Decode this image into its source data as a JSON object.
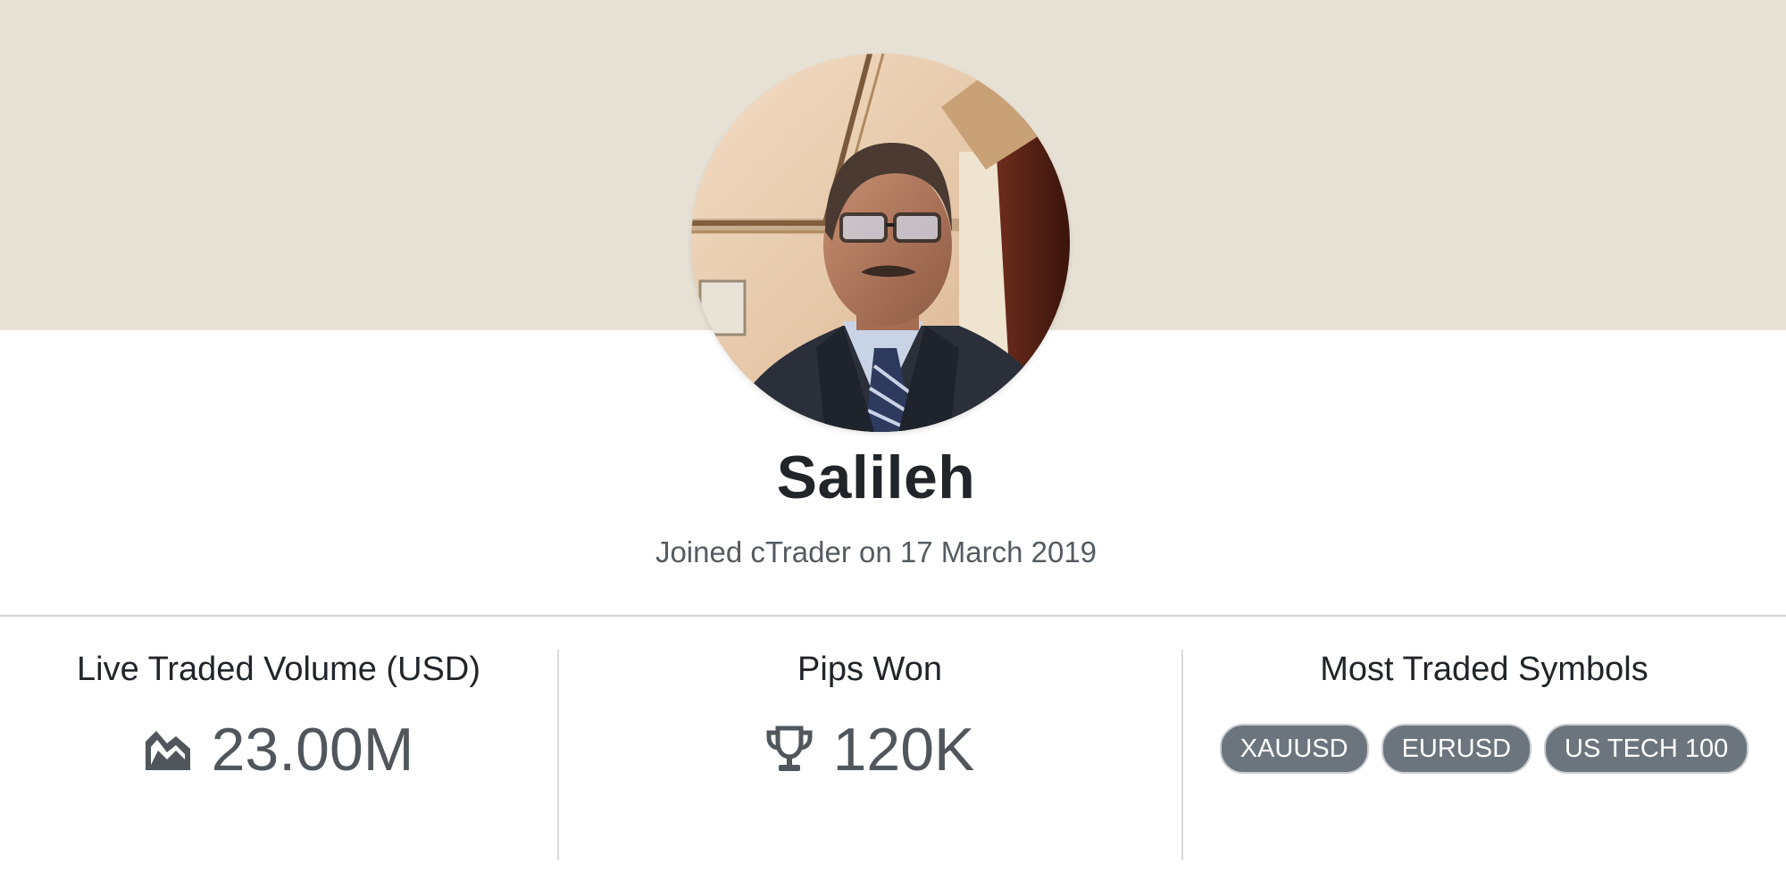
{
  "profile": {
    "name": "Salileh",
    "joined": "Joined cTrader on 17 March 2019"
  },
  "stats": [
    {
      "title": "Live Traded Volume (USD)",
      "value": "23.00M",
      "icon": "chart-area-icon"
    },
    {
      "title": "Pips Won",
      "value": "120K",
      "icon": "trophy-icon"
    },
    {
      "title": "Most Traded Symbols",
      "symbols": [
        "XAUUSD",
        "EURUSD",
        "US TECH 100"
      ]
    }
  ],
  "colors": {
    "cover": "#e7e0d4",
    "chip": "#6c757d",
    "muted_text": "#50565c"
  }
}
